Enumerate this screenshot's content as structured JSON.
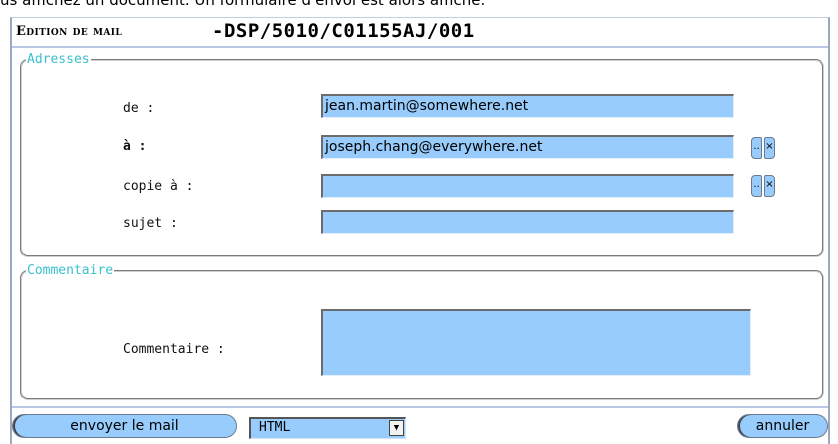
{
  "page_caption": "us affichez un document. Un formulaire d'envoi est alors affiché.",
  "window": {
    "title_prefix": "Edition de mail",
    "title_code": "-DSP/5010/C01155AJ/001"
  },
  "groups": {
    "adresses": {
      "legend": "Adresses",
      "fields": {
        "de": {
          "label": "de :",
          "value": "jean.martin@somewhere.net"
        },
        "a": {
          "label": "à :",
          "value": "joseph.chang@everywhere.net"
        },
        "copie": {
          "label": "copie à :",
          "value": ""
        },
        "sujet": {
          "label": "sujet :",
          "value": ""
        }
      },
      "picker_button_label": "..",
      "clear_button_label": "×"
    },
    "commentaire": {
      "legend": "Commentaire",
      "label": "Commentaire :",
      "value": ""
    }
  },
  "footer": {
    "send_button": "envoyer le mail",
    "format_select": {
      "selected": "HTML"
    },
    "cancel_button": "annuler"
  },
  "colors": {
    "field_bg": "#98ccfc",
    "legend": "#39c0cc",
    "separator": "#b9c7e4"
  }
}
